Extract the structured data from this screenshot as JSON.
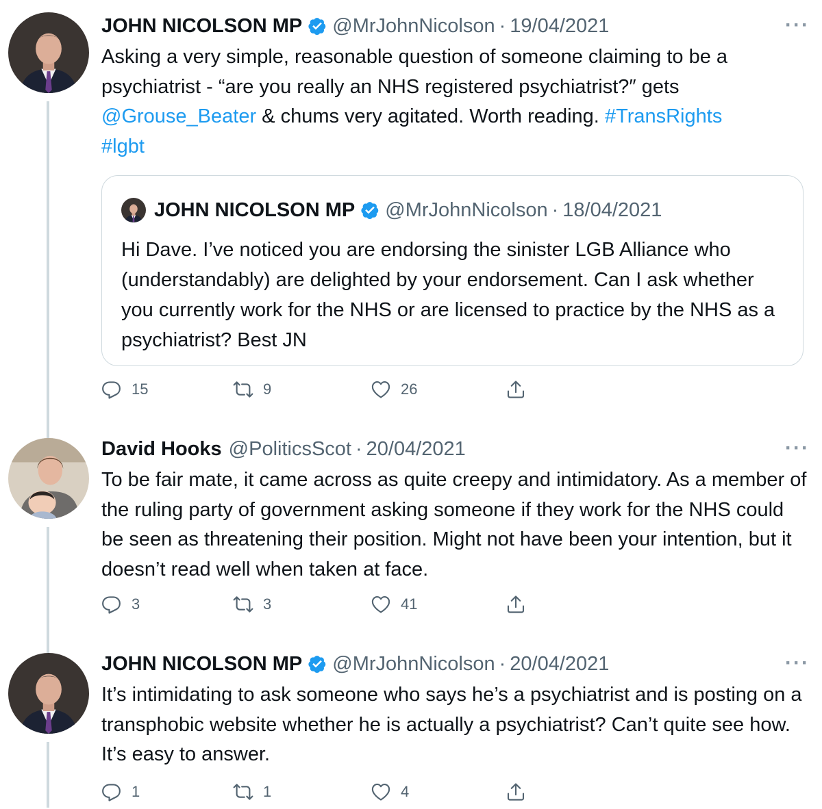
{
  "icons": {
    "verified": "verified-badge-icon",
    "more": "more-options-icon",
    "reply": "reply-icon",
    "retweet": "retweet-icon",
    "like": "heart-icon",
    "share": "share-icon"
  },
  "colors": {
    "link": "#1d9bf0",
    "verified": "#1d9bf0",
    "secondary": "#536471",
    "thread_line": "#cfd9de"
  },
  "tweets": [
    {
      "name": "JOHN NICOLSON MP",
      "verified": true,
      "handle": "@MrJohnNicolson",
      "separator": "·",
      "date": "19/04/2021",
      "more": "···",
      "text_parts": {
        "p1": "Asking a very simple, reasonable question of someone claiming to be a psychiatrist - “are you really an NHS registered psychiatrist?″ gets ",
        "mention": "@Grouse_Beater",
        "p2": " & chums very agitated. Worth reading. ",
        "hashtag1": "#TransRights",
        "hashtag2": "#lgbt"
      },
      "quote": {
        "name": "JOHN NICOLSON MP",
        "handle": "@MrJohnNicolson",
        "separator": "·",
        "date": "18/04/2021",
        "text": "Hi Dave. I’ve noticed you are endorsing the sinister LGB Alliance who (understandably) are delighted by your endorsement. Can I ask whether you currently work for the NHS or are licensed to practice by the NHS as a psychiatrist? Best JN"
      },
      "stats": {
        "replies": "15",
        "retweets": "9",
        "likes": "26"
      }
    },
    {
      "name": "David Hooks",
      "verified": false,
      "handle": "@PoliticsScot",
      "separator": "·",
      "date": "20/04/2021",
      "more": "···",
      "text": "To be fair mate, it came across as quite creepy and intimidatory. As a member of the ruling party of government asking someone if they work for the NHS could be seen as threatening their position. Might not have been your intention, but it doesn’t read well when taken at face.",
      "stats": {
        "replies": "3",
        "retweets": "3",
        "likes": "41"
      }
    },
    {
      "name": "JOHN NICOLSON MP",
      "verified": true,
      "handle": "@MrJohnNicolson",
      "separator": "·",
      "date": "20/04/2021",
      "more": "···",
      "text": "It’s intimidating to ask someone who says he’s a psychiatrist and is posting on a transphobic website whether he is actually a psychiatrist? Can’t quite see how. It’s easy to answer.",
      "stats": {
        "replies": "1",
        "retweets": "1",
        "likes": "4"
      }
    }
  ]
}
